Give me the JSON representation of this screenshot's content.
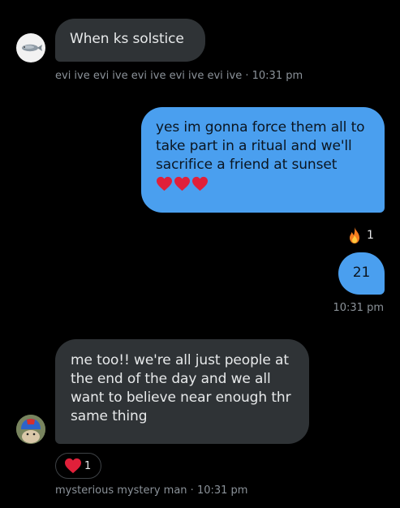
{
  "conversation": {
    "messages": [
      {
        "direction": "incoming",
        "lines": [
          "When ks solstice"
        ],
        "meta": "evi ive evi ive evi ive evi ive evi ive · 10:31 pm",
        "avatar_icon": "fish-avatar-icon"
      },
      {
        "direction": "outgoing",
        "lines": [
          "yes im gonna force them all to",
          "take part in a ritual and we'll",
          "sacrifice a friend at sunset"
        ],
        "trailing_icons": [
          "heart-icon",
          "heart-icon",
          "heart-icon"
        ]
      },
      {
        "direction": "outgoing",
        "reaction": {
          "icon": "fire-icon",
          "count": "1"
        },
        "lines": [
          "21"
        ],
        "meta": "10:31 pm"
      },
      {
        "direction": "incoming",
        "lines": [
          "me too!! we're all just people at",
          "the end of the day and we all",
          "want to believe near enough thr",
          "same thing"
        ],
        "reaction": {
          "icon": "heart-icon",
          "count": "1"
        },
        "meta": "mysterious mystery man · 10:31 pm",
        "avatar_icon": "helmet-avatar-icon"
      }
    ]
  },
  "colors": {
    "background": "#000000",
    "incoming_bubble": "#2f3336",
    "outgoing_bubble": "#4a9fef",
    "meta_text": "#8b9299",
    "heart": "#e0203a"
  }
}
